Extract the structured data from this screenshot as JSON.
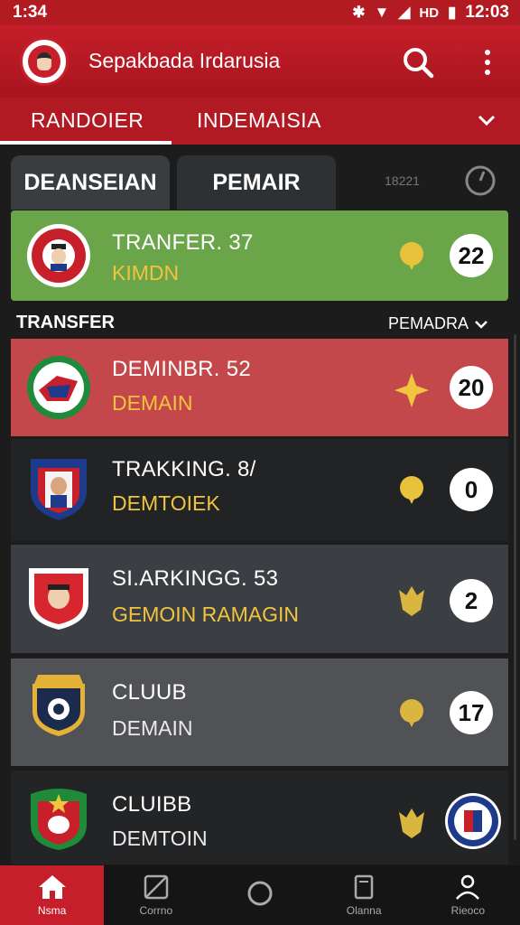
{
  "status": {
    "time_left": "1:34",
    "time_right": "12:03",
    "signal_label": "HD"
  },
  "app": {
    "title": "Sepakbada Irdarusia"
  },
  "tabs": [
    {
      "label": "RANDOIER"
    },
    {
      "label": "INDEMAISIA"
    }
  ],
  "segments": [
    {
      "label": "DEANSEIAN"
    },
    {
      "label": "PEMAIR"
    }
  ],
  "segment_count": "18221",
  "highlight": {
    "title": "TRANFER. 37",
    "subtitle": "KIMDN",
    "count": "22"
  },
  "section": {
    "label": "TRANSFER",
    "sort_label": "PEMADRA"
  },
  "rows": [
    {
      "title": "DEMINBR. 52",
      "subtitle": "DEMAIN",
      "count": "20",
      "action_icon": "star-icon"
    },
    {
      "title": "TRAKKING. 8/",
      "subtitle": "DEMTOIEK",
      "count": "0",
      "action_icon": "pin-icon"
    },
    {
      "title": "SI.ARKINGG. 53",
      "subtitle": "GEMOIN RAMAGIN",
      "count": "2",
      "action_icon": "shield-icon"
    },
    {
      "title": "CLUUB",
      "subtitle": "DEMAIN",
      "count": "17",
      "action_icon": "pin-icon"
    },
    {
      "title": "CLUIBB",
      "subtitle": "DEMTOIN",
      "count": "",
      "action_icon": "shield-icon"
    }
  ],
  "nav": [
    {
      "label": "Nsma",
      "icon": "home-icon"
    },
    {
      "label": "Corrno",
      "icon": "map-icon"
    },
    {
      "label": "",
      "icon": "circle-icon"
    },
    {
      "label": "Olanna",
      "icon": "document-icon"
    },
    {
      "label": "Rieoco",
      "icon": "profile-icon"
    }
  ],
  "colors": {
    "brand_red": "#c41f2a",
    "highlight_green": "#6aa54a",
    "row_red": "#c4484b",
    "gold": "#f1c43f"
  }
}
